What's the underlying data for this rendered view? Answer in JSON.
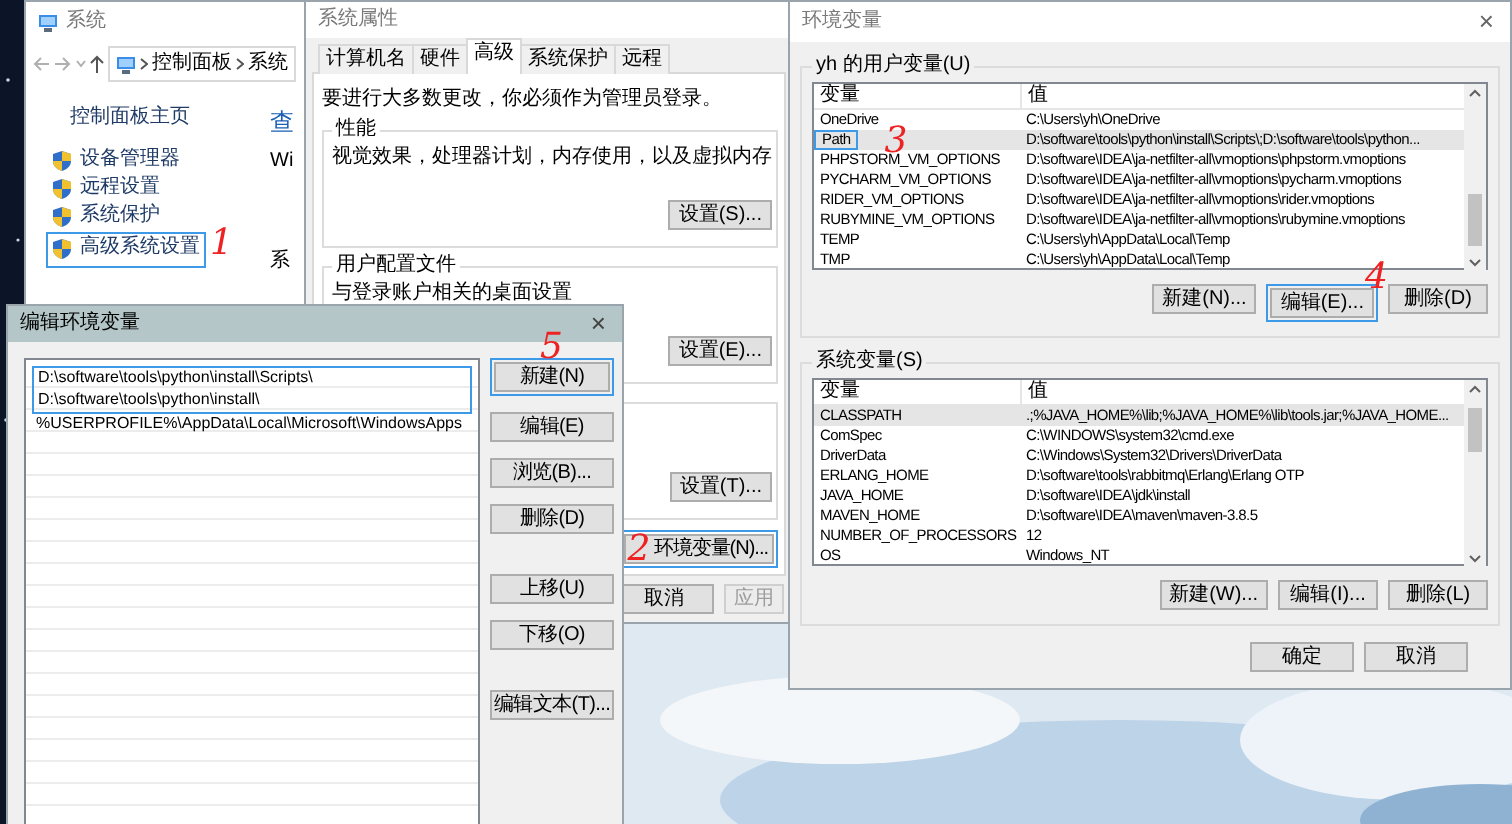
{
  "system_window": {
    "title": "系统",
    "breadcrumbs": [
      "控制面板",
      "系统"
    ],
    "home_link": "控制面板主页",
    "sidebar_items": [
      {
        "label": "设备管理器",
        "boxed": false
      },
      {
        "label": "远程设置",
        "boxed": false
      },
      {
        "label": "系统保护",
        "boxed": false
      },
      {
        "label": "高级系统设置",
        "boxed": true,
        "note": "1"
      }
    ],
    "content_fragments": [
      {
        "text": "查",
        "kind": "link"
      },
      {
        "text": "Wi",
        "kind": "text"
      },
      {
        "text": "系",
        "kind": "text"
      }
    ]
  },
  "system_properties": {
    "title": "系统属性",
    "tabs": [
      {
        "label": "计算机名",
        "selected": false
      },
      {
        "label": "硬件",
        "selected": false
      },
      {
        "label": "高级",
        "selected": true
      },
      {
        "label": "系统保护",
        "selected": false
      },
      {
        "label": "远程",
        "selected": false
      }
    ],
    "notice": "要进行大多数更改，你必须作为管理员登录。",
    "groups": [
      {
        "title": "性能",
        "text": "视觉效果，处理器计划，内存使用，以及虚拟内存",
        "button": {
          "label": "设置(S)..."
        }
      },
      {
        "title": "用户配置文件",
        "text": "与登录账户相关的桌面设置",
        "button": {
          "label": "设置(E)..."
        }
      },
      {
        "button": {
          "label": "设置(T)..."
        }
      }
    ],
    "env_button": {
      "label": "环境变量(N)...",
      "boxed": true,
      "note": "2"
    },
    "footer_buttons": [
      {
        "label": "取消",
        "disabled": false
      },
      {
        "label": "应用",
        "disabled": true
      }
    ]
  },
  "env_dialog": {
    "title": "环境变量",
    "close": "×",
    "user_section": {
      "title": "yh 的用户变量(U)",
      "columns": [
        "变量",
        "值"
      ],
      "rows": [
        {
          "name": "OneDrive",
          "value": "C:\\Users\\yh\\OneDrive",
          "selected": false,
          "boxed": false
        },
        {
          "name": "Path",
          "value": "D:\\software\\tools\\python\\install\\Scripts\\;D:\\software\\tools\\python...",
          "selected": true,
          "boxed": true,
          "note": "3"
        },
        {
          "name": "PHPSTORM_VM_OPTIONS",
          "value": "D:\\software\\IDEA\\ja-netfilter-all\\vmoptions\\phpstorm.vmoptions",
          "selected": false,
          "boxed": false
        },
        {
          "name": "PYCHARM_VM_OPTIONS",
          "value": "D:\\software\\IDEA\\ja-netfilter-all\\vmoptions\\pycharm.vmoptions",
          "selected": false,
          "boxed": false
        },
        {
          "name": "RIDER_VM_OPTIONS",
          "value": "D:\\software\\IDEA\\ja-netfilter-all\\vmoptions\\rider.vmoptions",
          "selected": false,
          "boxed": false
        },
        {
          "name": "RUBYMINE_VM_OPTIONS",
          "value": "D:\\software\\IDEA\\ja-netfilter-all\\vmoptions\\rubymine.vmoptions",
          "selected": false,
          "boxed": false
        },
        {
          "name": "TEMP",
          "value": "C:\\Users\\yh\\AppData\\Local\\Temp",
          "selected": false,
          "boxed": false
        },
        {
          "name": "TMP",
          "value": "C:\\Users\\yh\\AppData\\Local\\Temp",
          "selected": false,
          "boxed": false
        }
      ],
      "buttons": [
        {
          "label": "新建(N)...",
          "boxed": false
        },
        {
          "label": "编辑(E)...",
          "boxed": true,
          "note": "4"
        },
        {
          "label": "删除(D)",
          "boxed": false
        }
      ]
    },
    "system_section": {
      "title": "系统变量(S)",
      "columns": [
        "变量",
        "值"
      ],
      "rows": [
        {
          "name": "CLASSPATH",
          "value": ".;%JAVA_HOME%\\lib;%JAVA_HOME%\\lib\\tools.jar;%JAVA_HOME...",
          "selected": true
        },
        {
          "name": "ComSpec",
          "value": "C:\\WINDOWS\\system32\\cmd.exe",
          "selected": false
        },
        {
          "name": "DriverData",
          "value": "C:\\Windows\\System32\\Drivers\\DriverData",
          "selected": false
        },
        {
          "name": "ERLANG_HOME",
          "value": "D:\\software\\tools\\rabbitmq\\Erlang\\Erlang OTP",
          "selected": false
        },
        {
          "name": "JAVA_HOME",
          "value": "D:\\software\\IDEA\\jdk\\install",
          "selected": false
        },
        {
          "name": "MAVEN_HOME",
          "value": "D:\\software\\IDEA\\maven\\maven-3.8.5",
          "selected": false
        },
        {
          "name": "NUMBER_OF_PROCESSORS",
          "value": "12",
          "selected": false
        },
        {
          "name": "OS",
          "value": "Windows_NT",
          "selected": false
        }
      ],
      "buttons": [
        {
          "label": "新建(W)..."
        },
        {
          "label": "编辑(I)..."
        },
        {
          "label": "删除(L)"
        }
      ]
    },
    "footer_buttons": [
      {
        "label": "确定"
      },
      {
        "label": "取消"
      }
    ]
  },
  "edit_dialog": {
    "title": "编辑环境变量",
    "close": "×",
    "entries": [
      {
        "text": "D:\\software\\tools\\python\\install\\Scripts\\",
        "boxed": true
      },
      {
        "text": "D:\\software\\tools\\python\\install\\",
        "boxed": true
      },
      {
        "text": "%USERPROFILE%\\AppData\\Local\\Microsoft\\WindowsApps",
        "boxed": false
      }
    ],
    "buttons": [
      {
        "label": "新建(N)",
        "boxed": true,
        "note": "5"
      },
      {
        "label": "编辑(E)",
        "boxed": false
      },
      {
        "label": "浏览(B)...",
        "boxed": false
      },
      {
        "label": "删除(D)",
        "boxed": false
      },
      {
        "label": "上移(U)",
        "boxed": false
      },
      {
        "label": "下移(O)",
        "boxed": false
      },
      {
        "label": "编辑文本(T)...",
        "boxed": false
      }
    ]
  }
}
